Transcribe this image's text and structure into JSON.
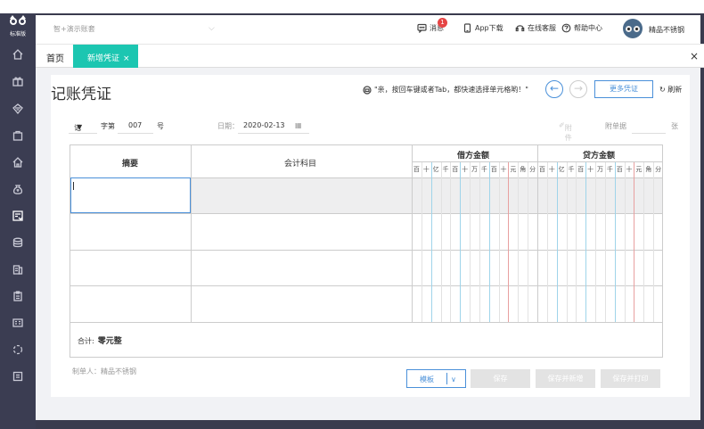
{
  "sidebar": {
    "logo_text": "标准版",
    "icons": [
      "home-icon",
      "gift-icon",
      "diamond-icon",
      "bag-icon",
      "house-icon",
      "money-bag-icon",
      "voucher-icon",
      "coins-icon",
      "book-icon",
      "clipboard-icon",
      "report-icon",
      "refresh-cycle-icon",
      "doc-icon"
    ]
  },
  "header": {
    "account_placeholder": "智+演示账套",
    "messages_label": "消息",
    "messages_badge": "1",
    "app_download": "App下载",
    "online_support": "在线客服",
    "help_center": "帮助中心",
    "user_name": "精品不锈钢"
  },
  "tabs": {
    "home": "首页",
    "active": "新增凭证",
    "active_close": "×",
    "close_all": "×"
  },
  "page": {
    "title": "记账凭证",
    "hint": "\"亲，按回车键或者Tab，都快速选择单元格哟！\"",
    "prev": "←",
    "next": "→",
    "more_vouchers": "更多凭证",
    "refresh": "刷新"
  },
  "meta": {
    "type_value": "记",
    "word_label": "字第",
    "number_value": "007",
    "number_suffix": "号",
    "date_label": "日期：",
    "date_value": "2020-02-13",
    "attachment_label": "附件",
    "docs_label": "附单据",
    "docs_unit": "张"
  },
  "table": {
    "col_summary": "摘要",
    "col_account": "会计科目",
    "col_debit": "借方金额",
    "col_credit": "贷方金额",
    "digits": [
      "百",
      "十",
      "亿",
      "千",
      "百",
      "十",
      "万",
      "千",
      "百",
      "十",
      "元",
      "角",
      "分"
    ],
    "total_label": "合计:",
    "total_value": "零元整"
  },
  "footer": {
    "maker": "制单人：精品不锈钢",
    "template": "模板",
    "template_caret": "∨",
    "save": "保存",
    "save_new": "保存并新增",
    "save_print": "保存并打印"
  }
}
